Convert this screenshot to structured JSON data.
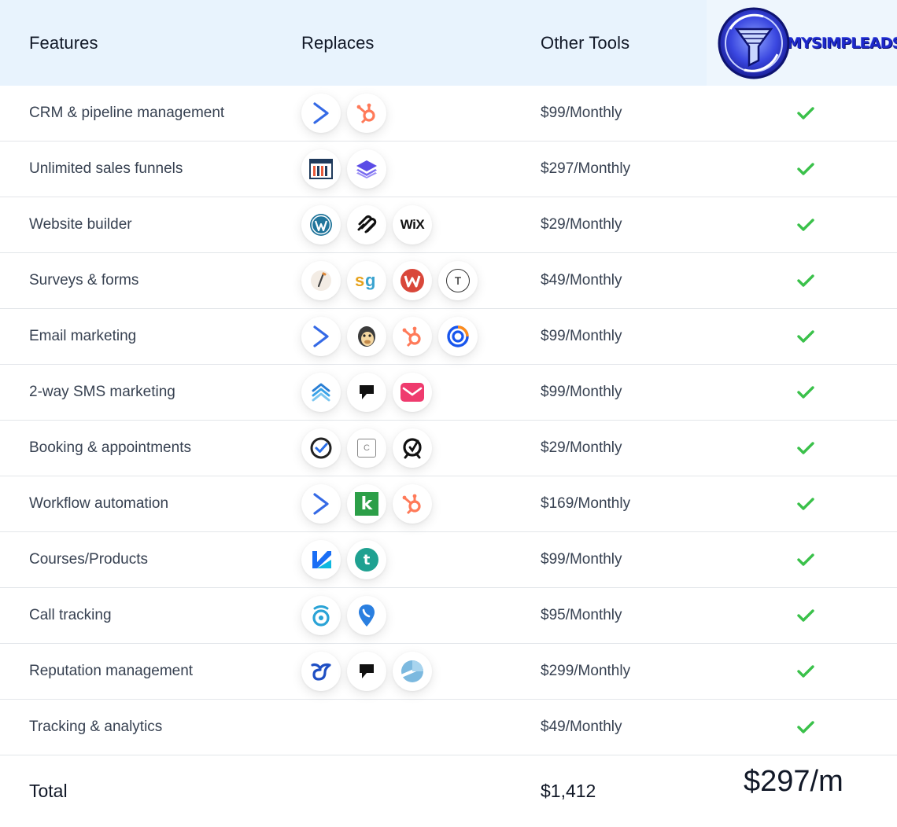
{
  "header": {
    "features": "Features",
    "replaces": "Replaces",
    "other_tools": "Other Tools",
    "brand": "MYSIMPLEADS"
  },
  "colors": {
    "header_bg": "#e8f3fd",
    "check": "#3ac14a",
    "brand_blue": "#1d28c9"
  },
  "rows": [
    {
      "feature": "CRM & pipeline management",
      "price": "$99/Monthly",
      "icons": [
        "activecampaign-icon",
        "hubspot-icon"
      ]
    },
    {
      "feature": "Unlimited sales funnels",
      "price": "$297/Monthly",
      "icons": [
        "clickfunnels-icon",
        "leadpages-icon"
      ]
    },
    {
      "feature": "Website builder",
      "price": "$29/Monthly",
      "icons": [
        "wordpress-icon",
        "squarespace-icon",
        "wix-icon"
      ]
    },
    {
      "feature": "Surveys & forms",
      "price": "$49/Monthly",
      "icons": [
        "jotform-icon",
        "surveygizmo-icon",
        "wufoo-icon",
        "typeform-icon"
      ]
    },
    {
      "feature": "Email marketing",
      "price": "$99/Monthly",
      "icons": [
        "activecampaign-icon",
        "mailchimp-icon",
        "hubspot-icon",
        "constant-contact-icon"
      ]
    },
    {
      "feature": "2-way SMS marketing",
      "price": "$99/Monthly",
      "icons": [
        "simpletexting-icon",
        "podium-icon",
        "eztexting-icon"
      ]
    },
    {
      "feature": "Booking & appointments",
      "price": "$29/Monthly",
      "icons": [
        "acuity-icon",
        "calendly-icon",
        "oncehub-icon"
      ]
    },
    {
      "feature": "Workflow automation",
      "price": "$169/Monthly",
      "icons": [
        "activecampaign-icon",
        "keap-icon",
        "hubspot-icon"
      ]
    },
    {
      "feature": "Courses/Products",
      "price": "$99/Monthly",
      "icons": [
        "kajabi-icon",
        "teachable-icon"
      ]
    },
    {
      "feature": "Call tracking",
      "price": "$95/Monthly",
      "icons": [
        "callrail-icon",
        "calltrackingmetrics-icon"
      ]
    },
    {
      "feature": "Reputation management",
      "price": "$299/Monthly",
      "icons": [
        "birdeye-icon",
        "podium-icon",
        "yext-icon"
      ]
    },
    {
      "feature": "Tracking & analytics",
      "price": "$49/Monthly",
      "icons": []
    }
  ],
  "wix_text": "WiX",
  "typeform_letter": "T",
  "keap_letter": "k",
  "teachable_letter": "t",
  "sg_text": "sg",
  "calendly_letter": "C",
  "total": {
    "label": "Total",
    "other": "$1,412",
    "ours": "$297/m"
  }
}
